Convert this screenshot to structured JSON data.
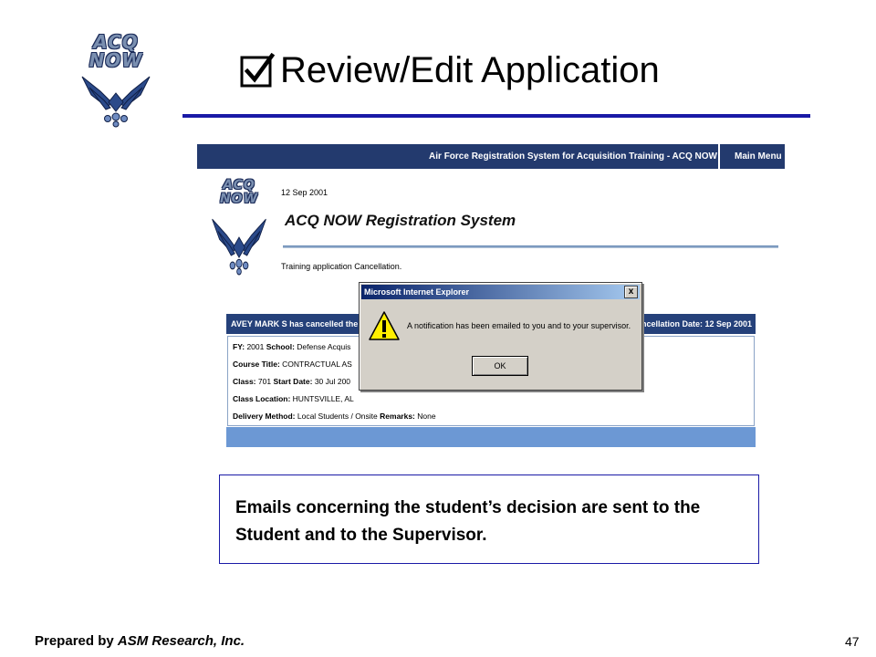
{
  "slide": {
    "logo_line1": "ACQ",
    "logo_line2": "NOW",
    "title": "Review/Edit Application",
    "title_icon": "checkbox-checked-icon"
  },
  "app": {
    "system_title_bar": "Air Force Registration System for Acquisition Training - ACQ NOW",
    "main_menu": "Main Menu",
    "logo_line1": "ACQ",
    "logo_line2": "NOW",
    "date": "12 Sep 2001",
    "system_name": "ACQ NOW Registration System",
    "subtitle": "Training application Cancellation."
  },
  "details": {
    "header_left": "AVEY MARK S has cancelled the",
    "header_right": "ancellation Date: 12 Sep 2001",
    "rows": [
      {
        "label1": "FY:",
        "value1": "2001",
        "label2": "School:",
        "value2": "Defense Acquis"
      },
      {
        "label1": "Course Title:",
        "value1": "CONTRACTUAL AS",
        "label2": "",
        "value2": ""
      },
      {
        "label1": "Class:",
        "value1": "701",
        "label2": "Start Date:",
        "value2": "30 Jul 200"
      },
      {
        "label1": "Class Location:",
        "value1": "HUNTSVILLE, AL",
        "label2": "",
        "value2": ""
      },
      {
        "label1": "Delivery Method:",
        "value1": "Local Students / Onsite",
        "label2": "Remarks:",
        "value2": "None"
      }
    ]
  },
  "dialog": {
    "title": "Microsoft Internet Explorer",
    "close_label": "x",
    "icon": "warning-icon",
    "message": "A notification has been emailed to you and to your supervisor.",
    "ok_label": "OK"
  },
  "callout": {
    "text": "Emails concerning the student’s decision are sent to the Student and to the Supervisor."
  },
  "footer": {
    "prepared_by": "Prepared by ",
    "company": "ASM Research, Inc.",
    "page_number": "47"
  },
  "colors": {
    "title_rule": "#1a1aa6",
    "app_bar": "#233a6e",
    "details_footer": "#6c98d4",
    "dialog_bg": "#d4d0c8"
  }
}
